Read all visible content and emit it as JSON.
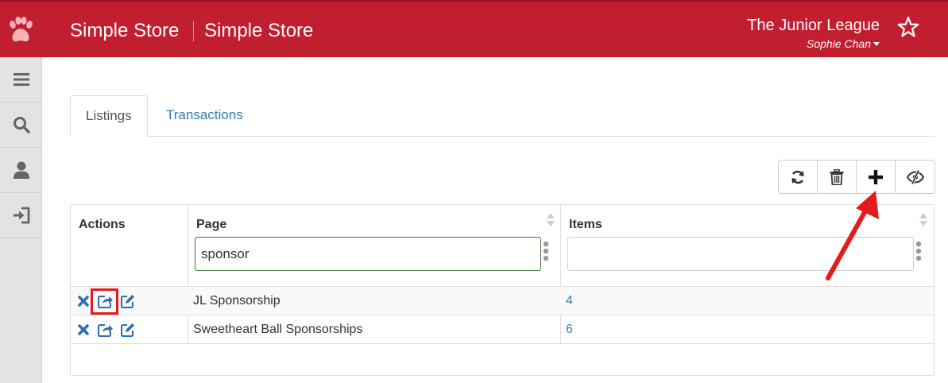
{
  "header": {
    "app_title": "Simple Store",
    "app_subtitle": "Simple Store",
    "org_name": "The Junior League",
    "user_name": "Sophie Chan",
    "logo_icon": "paw-icon",
    "star_icon": "star-outline-icon",
    "brand_color": "#c11e2f"
  },
  "sidebar": {
    "items": [
      {
        "icon": "hamburger-menu-icon"
      },
      {
        "icon": "search-icon"
      },
      {
        "icon": "user-icon"
      },
      {
        "icon": "sign-in-icon"
      }
    ]
  },
  "tabs": [
    {
      "label": "Listings",
      "active": true
    },
    {
      "label": "Transactions",
      "active": false
    }
  ],
  "toolbar": {
    "buttons": [
      {
        "icon": "refresh-icon"
      },
      {
        "icon": "trash-icon"
      },
      {
        "icon": "plus-icon"
      },
      {
        "icon": "eye-slash-icon"
      }
    ]
  },
  "table": {
    "columns": [
      {
        "label": "Actions",
        "sortable": false
      },
      {
        "label": "Page",
        "sortable": true,
        "filter_value": "sponsor",
        "filter_placeholder": ""
      },
      {
        "label": "Items",
        "sortable": true,
        "filter_value": "",
        "filter_placeholder": ""
      }
    ],
    "rows": [
      {
        "page": "JL Sponsorship",
        "items": "4"
      },
      {
        "page": "Sweetheart Ball Sponsorships",
        "items": "6"
      }
    ],
    "row_action_icons": [
      "delete-x-icon",
      "share-icon",
      "edit-icon"
    ]
  },
  "colors": {
    "link": "#337ab7",
    "annotation": "#e31b1b"
  }
}
